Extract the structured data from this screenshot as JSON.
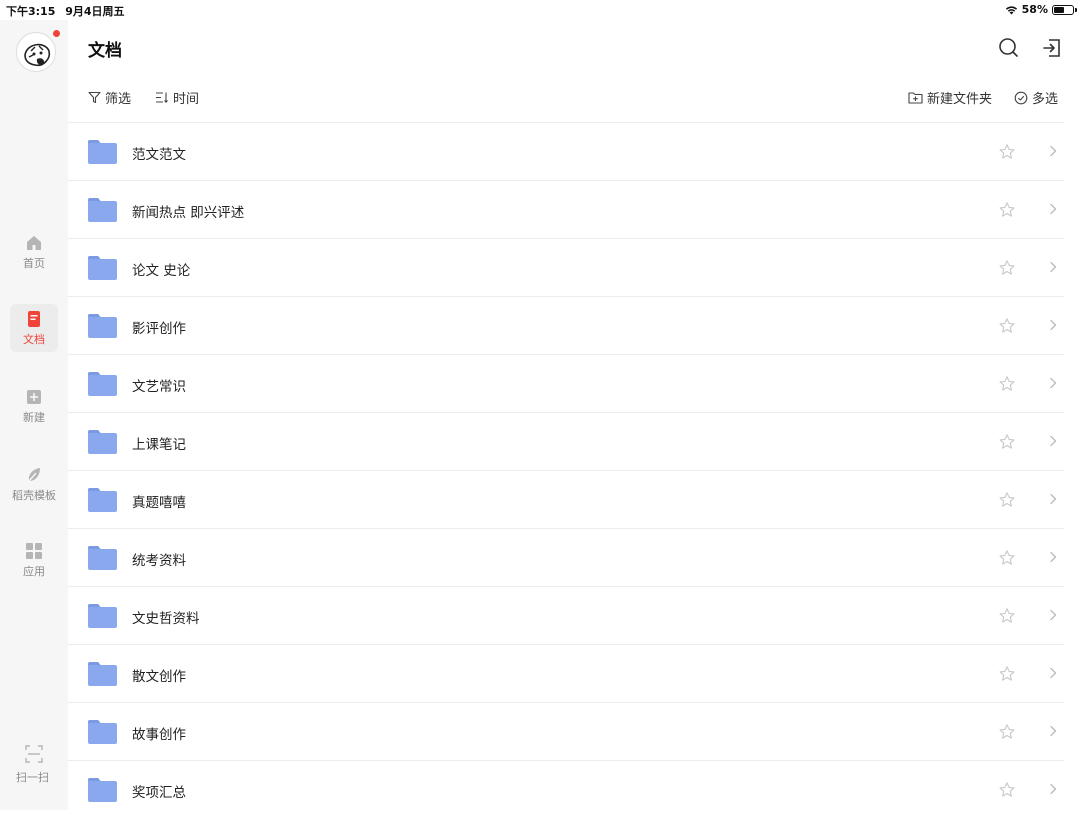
{
  "status": {
    "time": "下午3:15",
    "date": "9月4日周五",
    "battery": "58%",
    "battery_level": 0.58
  },
  "sidebar": {
    "items": [
      {
        "label": "首页",
        "icon": "home-icon"
      },
      {
        "label": "文档",
        "icon": "document-icon",
        "active": true
      },
      {
        "label": "新建",
        "icon": "plus-icon"
      },
      {
        "label": "稻壳模板",
        "icon": "leaf-icon"
      },
      {
        "label": "应用",
        "icon": "grid-icon"
      }
    ],
    "scan_label": "扫一扫"
  },
  "header": {
    "title": "文档"
  },
  "toolbar": {
    "filter_label": "筛选",
    "sort_label": "时间",
    "new_folder_label": "新建文件夹",
    "multi_select_label": "多选"
  },
  "colors": {
    "accent": "#f0443a",
    "folder": "#8aa8ee",
    "folder_tab": "#7b9ae6"
  },
  "folders": [
    {
      "name": "范文范文"
    },
    {
      "name": "新闻热点 即兴评述"
    },
    {
      "name": "论文 史论"
    },
    {
      "name": "影评创作"
    },
    {
      "name": "文艺常识"
    },
    {
      "name": "上课笔记"
    },
    {
      "name": "真题嘻嘻"
    },
    {
      "name": "统考资料"
    },
    {
      "name": "文史哲资料"
    },
    {
      "name": "散文创作"
    },
    {
      "name": "故事创作"
    },
    {
      "name": "奖项汇总"
    }
  ]
}
